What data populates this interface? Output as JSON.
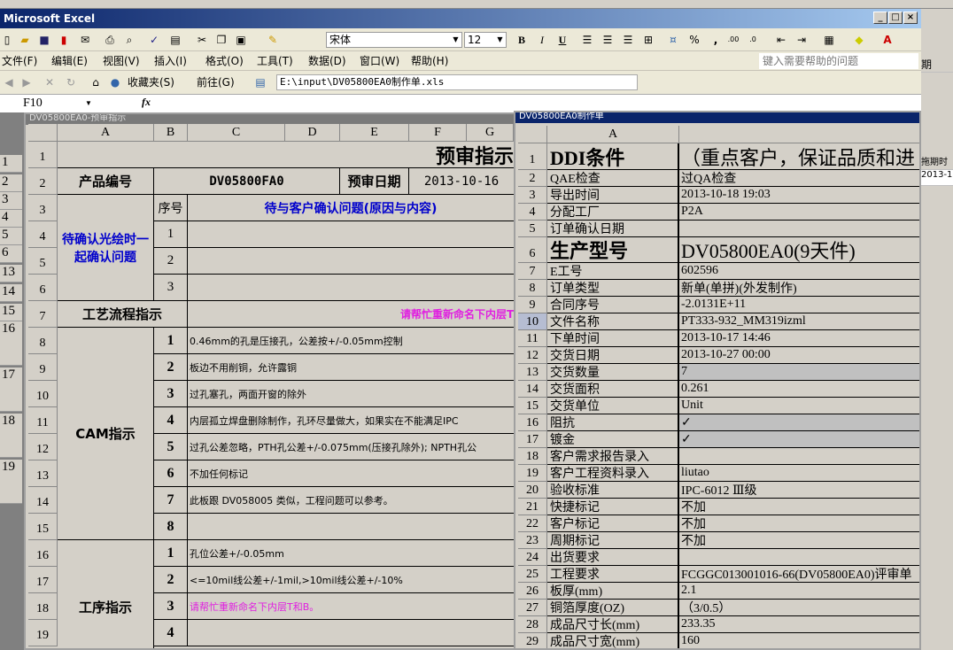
{
  "window": {
    "title": "Microsoft Excel",
    "minimize": "_",
    "maximize": "□",
    "close": "×"
  },
  "toolbar": {
    "font": "宋体",
    "size": "12",
    "bold": "B",
    "italic": "I",
    "underline": "U",
    "percent": "%",
    "comma": ",",
    "inc_decimal": ".00",
    "dec_decimal": ".0"
  },
  "menu": [
    "文件(F)",
    "编辑(E)",
    "视图(V)",
    "插入(I)",
    "格式(O)",
    "工具(T)",
    "数据(D)",
    "窗口(W)",
    "帮助(H)"
  ],
  "help_placeholder": "键入需要帮助的问题",
  "web": {
    "favorites": "收藏夹(S)",
    "go": "前往(G)",
    "address": "E:\\input\\DV05800EA0制作单.xls"
  },
  "formula": {
    "namebox": "F10",
    "fx": "fx",
    "value": ""
  },
  "bg_right": {
    "header": "期",
    "h2": "拖期时",
    "v2": "2013-1"
  },
  "bg_left_rows": [
    "1",
    "2",
    "3",
    "4",
    "5",
    "6",
    "13",
    "14",
    "15",
    "16",
    "17",
    "18",
    "19"
  ],
  "left_sheet": {
    "title": "DV05800EA0-预审指示",
    "columns": [
      "A",
      "B",
      "C",
      "D",
      "E",
      "F",
      "G"
    ],
    "rows": [
      "1",
      "2",
      "3",
      "4",
      "5",
      "6",
      "7",
      "8",
      "9",
      "10",
      "11",
      "12",
      "13",
      "14",
      "15",
      "16",
      "17",
      "18",
      "19"
    ],
    "heading": "预审指示",
    "product_label": "产品编号",
    "product_value": "DV05800FA0",
    "date_label": "预审日期",
    "date_value": "2013-10-16",
    "confirm_group": "待确认光绘时一起确认问题",
    "seq_label": "序号",
    "confirm_header": "待与客户确认问题(原因与内容)",
    "confirm_items": [
      "1",
      "2",
      "3"
    ],
    "process_label": "工艺流程指示",
    "process_note": "请帮忙重新命名下内层T和B。",
    "cam_label": "CAM指示",
    "cam_items": [
      {
        "n": "1",
        "t": "0.46mm的孔是压接孔，公差按+/-0.05mm控制"
      },
      {
        "n": "2",
        "t": "板边不用削铜，允许露铜"
      },
      {
        "n": "3",
        "t": "过孔塞孔，两面开窗的除外"
      },
      {
        "n": "4",
        "t": "内层孤立焊盘删除制作，孔环尽量做大，如果实在不能满足IPC"
      },
      {
        "n": "5",
        "t": "过孔公差忽略，PTH孔公差+/-0.075mm(压接孔除外); NPTH孔公"
      },
      {
        "n": "6",
        "t": "不加任何标记"
      },
      {
        "n": "7",
        "t": "此板跟 DV058005 类似，工程问题可以参考。"
      },
      {
        "n": "8",
        "t": ""
      }
    ],
    "proc_label": "工序指示",
    "proc_items": [
      {
        "n": "1",
        "t": "孔位公差+/-0.05mm",
        "c": "#000"
      },
      {
        "n": "2",
        "t": "<=10mil线公差+/-1mil,>10mil线公差+/-10%",
        "c": "#000"
      },
      {
        "n": "3",
        "t": "请帮忙重新命名下内层T和B。",
        "c": "#e020e0"
      },
      {
        "n": "4",
        "t": "",
        "c": "#000"
      }
    ]
  },
  "right_sheet": {
    "title": "DV05800EA0制作单",
    "column": "A",
    "rows": [
      {
        "n": "1",
        "k": "DDI条件",
        "v": "（重点客户，保证品质和进",
        "big": true
      },
      {
        "n": "2",
        "k": "QAE检查",
        "v": "过QA检查"
      },
      {
        "n": "3",
        "k": "导出时间",
        "v": "2013-10-18 19:03"
      },
      {
        "n": "4",
        "k": "分配工厂",
        "v": "P2A"
      },
      {
        "n": "5",
        "k": "订单确认日期",
        "v": ""
      },
      {
        "n": "6",
        "k": "生产型号",
        "v": "DV05800EA0(9天件)",
        "big": true
      },
      {
        "n": "7",
        "k": "E工号",
        "v": "602596"
      },
      {
        "n": "8",
        "k": "订单类型",
        "v": "新单(单拼)(外发制作)"
      },
      {
        "n": "9",
        "k": "合同序号",
        "v": "-2.0131E+11"
      },
      {
        "n": "10",
        "k": "文件名称",
        "v": "PT333-932_MM319izml",
        "sel": true
      },
      {
        "n": "11",
        "k": "下单时间",
        "v": "2013-10-17 14:46"
      },
      {
        "n": "12",
        "k": "交货日期",
        "v": "2013-10-27 00:00"
      },
      {
        "n": "13",
        "k": "交货数量",
        "v": "7",
        "gray": true
      },
      {
        "n": "14",
        "k": "交货面积",
        "v": "0.261"
      },
      {
        "n": "15",
        "k": "交货单位",
        "v": "Unit"
      },
      {
        "n": "16",
        "k": "阻抗",
        "v": "✓",
        "gray": true
      },
      {
        "n": "17",
        "k": "镀金",
        "v": "✓",
        "gray": true
      },
      {
        "n": "18",
        "k": "客户需求报告录入",
        "v": ""
      },
      {
        "n": "19",
        "k": "客户工程资料录入",
        "v": "liutao"
      },
      {
        "n": "20",
        "k": "验收标准",
        "v": "IPC-6012 Ⅲ级"
      },
      {
        "n": "21",
        "k": "快捷标记",
        "v": "不加"
      },
      {
        "n": "22",
        "k": "客户标记",
        "v": "不加"
      },
      {
        "n": "23",
        "k": "周期标记",
        "v": "不加"
      },
      {
        "n": "24",
        "k": "出货要求",
        "v": ""
      },
      {
        "n": "25",
        "k": "工程要求",
        "v": "FCGGC013001016-66(DV05800EA0)评审单"
      },
      {
        "n": "26",
        "k": "板厚(mm)",
        "v": "2.1"
      },
      {
        "n": "27",
        "k": "铜箔厚度(OZ)",
        "v": "（3/0.5）"
      },
      {
        "n": "28",
        "k": "成品尺寸长(mm)",
        "v": "233.35"
      },
      {
        "n": "29",
        "k": "成品尺寸宽(mm)",
        "v": "160"
      }
    ]
  },
  "colors": {
    "title_blue": "#0a246a",
    "confirm_blue": "#0000cc",
    "magenta": "#e020e0",
    "gray_fill": "#c0c0c0"
  }
}
